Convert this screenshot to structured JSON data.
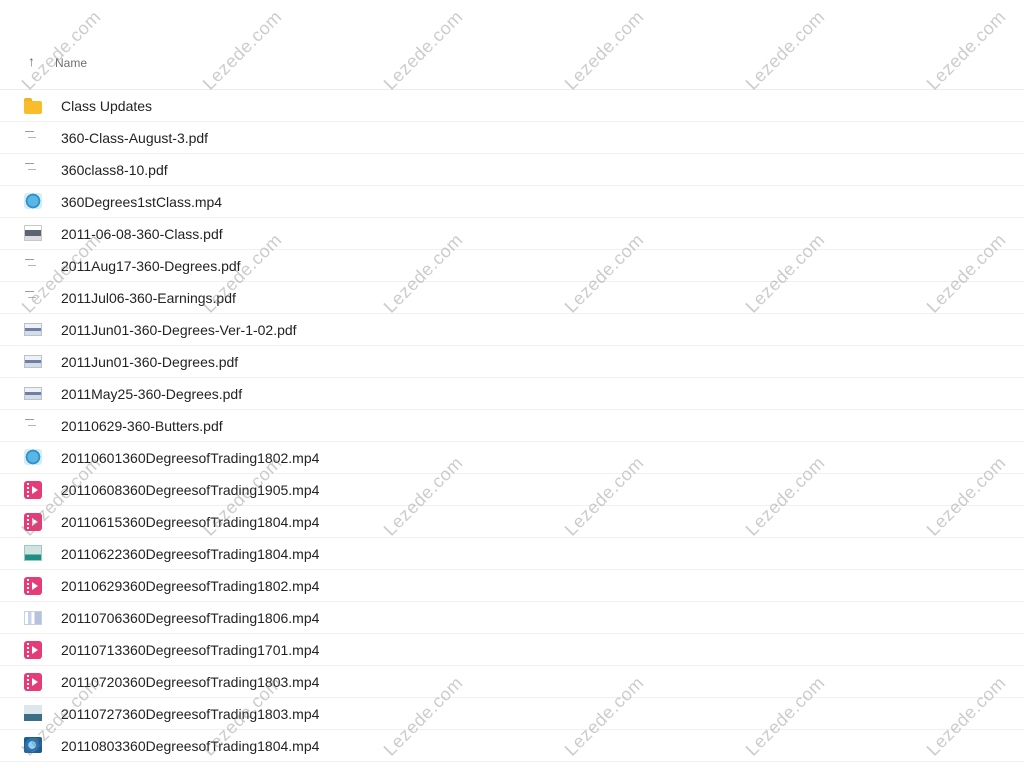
{
  "header": {
    "sort_icon": "arrow-up-icon",
    "name_column": "Name"
  },
  "files": [
    {
      "name": "Class Updates",
      "icon": "folder-icon"
    },
    {
      "name": "360-Class-August-3.pdf",
      "icon": "pdf-thumbnail-icon"
    },
    {
      "name": "360class8-10.pdf",
      "icon": "pdf-thumbnail-icon"
    },
    {
      "name": "360Degrees1stClass.mp4",
      "icon": "video-thumbnail-icon"
    },
    {
      "name": "2011-06-08-360-Class.pdf",
      "icon": "pdf-thumbnail-icon"
    },
    {
      "name": "2011Aug17-360-Degrees.pdf",
      "icon": "pdf-thumbnail-icon"
    },
    {
      "name": "2011Jul06-360-Earnings.pdf",
      "icon": "pdf-thumbnail-icon"
    },
    {
      "name": "2011Jun01-360-Degrees-Ver-1-02.pdf",
      "icon": "pdf-thumbnail-icon"
    },
    {
      "name": "2011Jun01-360-Degrees.pdf",
      "icon": "pdf-thumbnail-icon"
    },
    {
      "name": "2011May25-360-Degrees.pdf",
      "icon": "pdf-thumbnail-icon"
    },
    {
      "name": "20110629-360-Butters.pdf",
      "icon": "pdf-thumbnail-icon"
    },
    {
      "name": "20110601360DegreesofTrading1802.mp4",
      "icon": "video-thumbnail-icon"
    },
    {
      "name": "20110608360DegreesofTrading1905.mp4",
      "icon": "video-file-icon"
    },
    {
      "name": "20110615360DegreesofTrading1804.mp4",
      "icon": "video-file-icon"
    },
    {
      "name": "20110622360DegreesofTrading1804.mp4",
      "icon": "video-thumbnail-icon"
    },
    {
      "name": "20110629360DegreesofTrading1802.mp4",
      "icon": "video-file-icon"
    },
    {
      "name": "20110706360DegreesofTrading1806.mp4",
      "icon": "video-thumbnail-icon"
    },
    {
      "name": "20110713360DegreesofTrading1701.mp4",
      "icon": "video-file-icon"
    },
    {
      "name": "20110720360DegreesofTrading1803.mp4",
      "icon": "video-file-icon"
    },
    {
      "name": "20110727360DegreesofTrading1803.mp4",
      "icon": "video-thumbnail-icon"
    },
    {
      "name": "20110803360DegreesofTrading1804.mp4",
      "icon": "video-thumbnail-icon"
    }
  ],
  "watermark": {
    "text": "Lezede.com"
  }
}
